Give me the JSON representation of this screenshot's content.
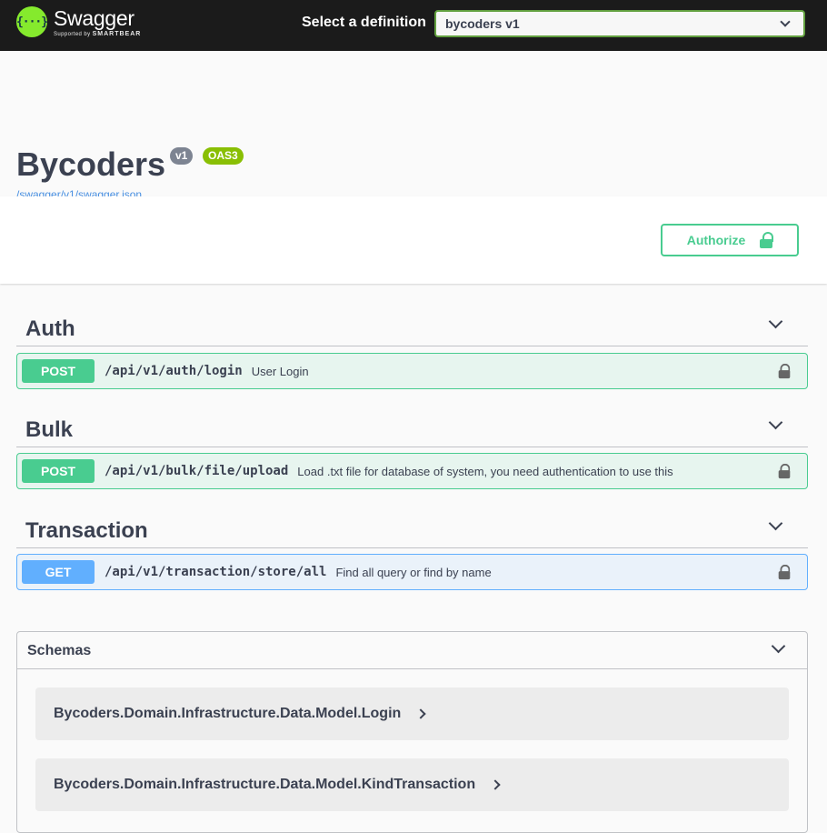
{
  "topbar": {
    "logo_glyph": "{···}",
    "logo_word": "Swagger",
    "logo_sub_prefix": "Supported by",
    "logo_sub_brand": "SMARTBEAR",
    "definition_label": "Select a definition",
    "definition_selected": "bycoders v1"
  },
  "info": {
    "title": "Bycoders",
    "version": "v1",
    "oas": "OAS3",
    "spec_url": "/swagger/v1/swagger.json"
  },
  "authorize": {
    "label": "Authorize"
  },
  "tags": [
    {
      "name": "Auth",
      "operations": [
        {
          "method": "POST",
          "path": "/api/v1/auth/login",
          "summary": "User Login"
        }
      ]
    },
    {
      "name": "Bulk",
      "operations": [
        {
          "method": "POST",
          "path": "/api/v1/bulk/file/upload",
          "summary": "Load .txt file for database of system, you need authentication to use this"
        }
      ]
    },
    {
      "name": "Transaction",
      "operations": [
        {
          "method": "GET",
          "path": "/api/v1/transaction/store/all",
          "summary": "Find all query or find by name"
        }
      ]
    }
  ],
  "schemas": {
    "title": "Schemas",
    "models": [
      "Bycoders.Domain.Infrastructure.Data.Model.Login",
      "Bycoders.Domain.Infrastructure.Data.Model.KindTransaction"
    ]
  },
  "colors": {
    "topbar": "#1b1b1b",
    "logo": "#85ea2d",
    "post": "#49cc90",
    "get": "#61affe",
    "select_border": "#62a03f",
    "version_badge": "#7d8492",
    "oas_badge": "#89bf04",
    "link": "#4990e2"
  },
  "icons": [
    "swagger-logo-icon",
    "chevron-down-icon",
    "lock-open-icon",
    "chevron-right-icon"
  ]
}
